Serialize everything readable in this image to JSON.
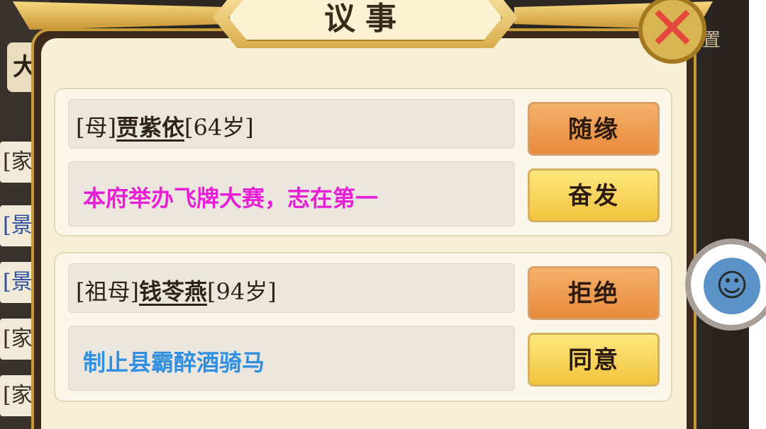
{
  "modal": {
    "title": "议事",
    "close_glyph": "✕"
  },
  "background": {
    "side_title": "大",
    "settings_label": "置",
    "rows": [
      "[家",
      "[景",
      "[景",
      "[家",
      "[家"
    ]
  },
  "proposals": [
    {
      "relation": "[母]",
      "name": "贾紫依",
      "age": "[64岁]",
      "event": "本府举办飞牌大赛，志在第一",
      "event_color": "#e81fd6",
      "primary_button": "随缘",
      "secondary_button": "奋发"
    },
    {
      "relation": "[祖母]",
      "name": "钱苓燕",
      "age": "[94岁]",
      "event": "制止县霸醉酒骑马",
      "event_color": "#2f8fe0",
      "primary_button": "拒绝",
      "secondary_button": "同意"
    }
  ],
  "icons": {
    "close": "close-icon",
    "avatar": "monkey-avatar-icon"
  }
}
